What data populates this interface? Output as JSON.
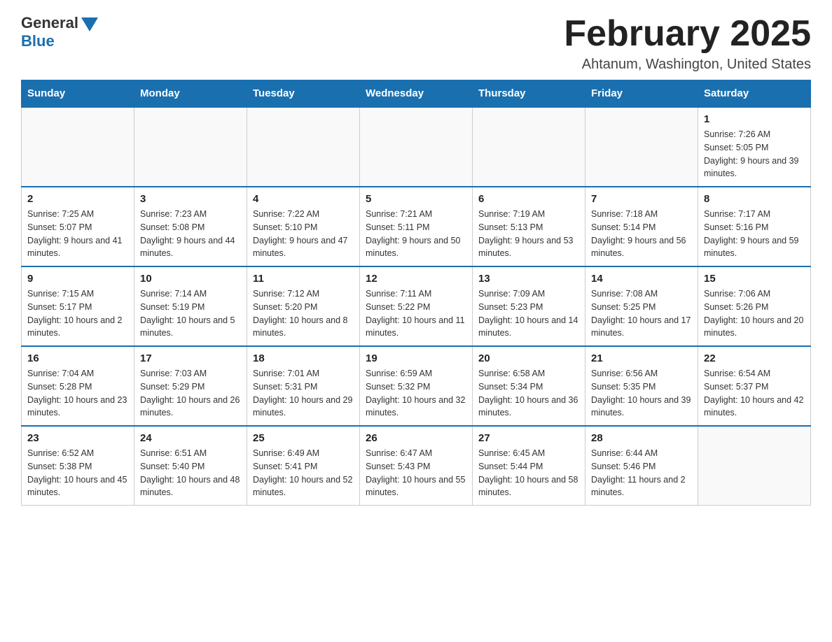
{
  "header": {
    "logo_general": "General",
    "logo_blue": "Blue",
    "title": "February 2025",
    "subtitle": "Ahtanum, Washington, United States"
  },
  "days_of_week": [
    "Sunday",
    "Monday",
    "Tuesday",
    "Wednesday",
    "Thursday",
    "Friday",
    "Saturday"
  ],
  "weeks": [
    [
      {
        "day": "",
        "info": ""
      },
      {
        "day": "",
        "info": ""
      },
      {
        "day": "",
        "info": ""
      },
      {
        "day": "",
        "info": ""
      },
      {
        "day": "",
        "info": ""
      },
      {
        "day": "",
        "info": ""
      },
      {
        "day": "1",
        "info": "Sunrise: 7:26 AM\nSunset: 5:05 PM\nDaylight: 9 hours and 39 minutes."
      }
    ],
    [
      {
        "day": "2",
        "info": "Sunrise: 7:25 AM\nSunset: 5:07 PM\nDaylight: 9 hours and 41 minutes."
      },
      {
        "day": "3",
        "info": "Sunrise: 7:23 AM\nSunset: 5:08 PM\nDaylight: 9 hours and 44 minutes."
      },
      {
        "day": "4",
        "info": "Sunrise: 7:22 AM\nSunset: 5:10 PM\nDaylight: 9 hours and 47 minutes."
      },
      {
        "day": "5",
        "info": "Sunrise: 7:21 AM\nSunset: 5:11 PM\nDaylight: 9 hours and 50 minutes."
      },
      {
        "day": "6",
        "info": "Sunrise: 7:19 AM\nSunset: 5:13 PM\nDaylight: 9 hours and 53 minutes."
      },
      {
        "day": "7",
        "info": "Sunrise: 7:18 AM\nSunset: 5:14 PM\nDaylight: 9 hours and 56 minutes."
      },
      {
        "day": "8",
        "info": "Sunrise: 7:17 AM\nSunset: 5:16 PM\nDaylight: 9 hours and 59 minutes."
      }
    ],
    [
      {
        "day": "9",
        "info": "Sunrise: 7:15 AM\nSunset: 5:17 PM\nDaylight: 10 hours and 2 minutes."
      },
      {
        "day": "10",
        "info": "Sunrise: 7:14 AM\nSunset: 5:19 PM\nDaylight: 10 hours and 5 minutes."
      },
      {
        "day": "11",
        "info": "Sunrise: 7:12 AM\nSunset: 5:20 PM\nDaylight: 10 hours and 8 minutes."
      },
      {
        "day": "12",
        "info": "Sunrise: 7:11 AM\nSunset: 5:22 PM\nDaylight: 10 hours and 11 minutes."
      },
      {
        "day": "13",
        "info": "Sunrise: 7:09 AM\nSunset: 5:23 PM\nDaylight: 10 hours and 14 minutes."
      },
      {
        "day": "14",
        "info": "Sunrise: 7:08 AM\nSunset: 5:25 PM\nDaylight: 10 hours and 17 minutes."
      },
      {
        "day": "15",
        "info": "Sunrise: 7:06 AM\nSunset: 5:26 PM\nDaylight: 10 hours and 20 minutes."
      }
    ],
    [
      {
        "day": "16",
        "info": "Sunrise: 7:04 AM\nSunset: 5:28 PM\nDaylight: 10 hours and 23 minutes."
      },
      {
        "day": "17",
        "info": "Sunrise: 7:03 AM\nSunset: 5:29 PM\nDaylight: 10 hours and 26 minutes."
      },
      {
        "day": "18",
        "info": "Sunrise: 7:01 AM\nSunset: 5:31 PM\nDaylight: 10 hours and 29 minutes."
      },
      {
        "day": "19",
        "info": "Sunrise: 6:59 AM\nSunset: 5:32 PM\nDaylight: 10 hours and 32 minutes."
      },
      {
        "day": "20",
        "info": "Sunrise: 6:58 AM\nSunset: 5:34 PM\nDaylight: 10 hours and 36 minutes."
      },
      {
        "day": "21",
        "info": "Sunrise: 6:56 AM\nSunset: 5:35 PM\nDaylight: 10 hours and 39 minutes."
      },
      {
        "day": "22",
        "info": "Sunrise: 6:54 AM\nSunset: 5:37 PM\nDaylight: 10 hours and 42 minutes."
      }
    ],
    [
      {
        "day": "23",
        "info": "Sunrise: 6:52 AM\nSunset: 5:38 PM\nDaylight: 10 hours and 45 minutes."
      },
      {
        "day": "24",
        "info": "Sunrise: 6:51 AM\nSunset: 5:40 PM\nDaylight: 10 hours and 48 minutes."
      },
      {
        "day": "25",
        "info": "Sunrise: 6:49 AM\nSunset: 5:41 PM\nDaylight: 10 hours and 52 minutes."
      },
      {
        "day": "26",
        "info": "Sunrise: 6:47 AM\nSunset: 5:43 PM\nDaylight: 10 hours and 55 minutes."
      },
      {
        "day": "27",
        "info": "Sunrise: 6:45 AM\nSunset: 5:44 PM\nDaylight: 10 hours and 58 minutes."
      },
      {
        "day": "28",
        "info": "Sunrise: 6:44 AM\nSunset: 5:46 PM\nDaylight: 11 hours and 2 minutes."
      },
      {
        "day": "",
        "info": ""
      }
    ]
  ]
}
